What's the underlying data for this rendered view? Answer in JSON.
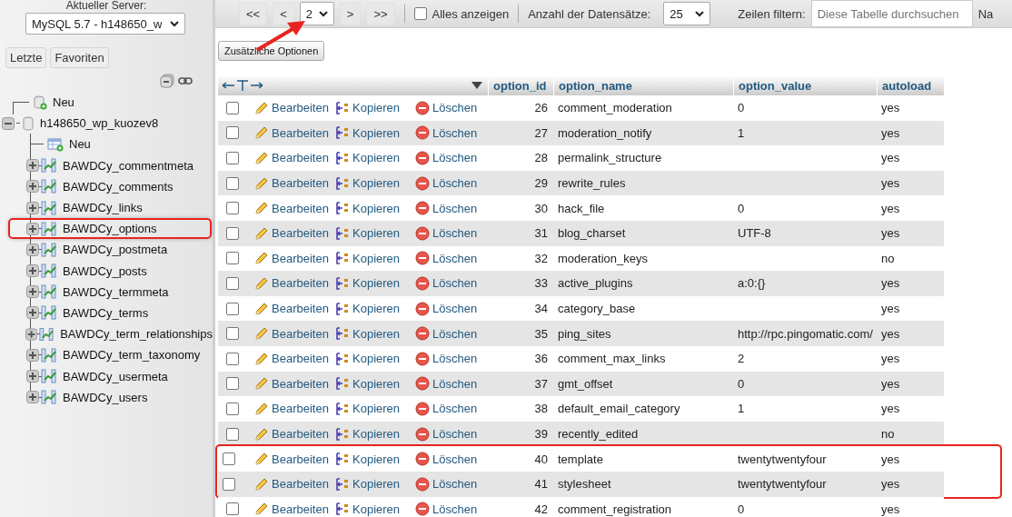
{
  "sidebar": {
    "server_label": "Aktueller Server:",
    "server_select": {
      "value": "MySQL 5.7 - h148650_w"
    },
    "buttons": [
      "Letzte",
      "Favoriten"
    ],
    "tree": [
      {
        "label": "Neu",
        "kind": "new"
      },
      {
        "label": "h148650_wp_kuozev8",
        "kind": "database",
        "expanded": true,
        "children": [
          {
            "label": "Neu",
            "kind": "new"
          },
          {
            "label": "BAWDCy_commentmeta",
            "kind": "table",
            "expanded": false,
            "highlighted": false
          },
          {
            "label": "BAWDCy_comments",
            "kind": "table",
            "expanded": false,
            "highlighted": false
          },
          {
            "label": "BAWDCy_links",
            "kind": "table",
            "expanded": false,
            "highlighted": false
          },
          {
            "label": "BAWDCy_options",
            "kind": "table",
            "expanded": false,
            "highlighted": true
          },
          {
            "label": "BAWDCy_postmeta",
            "kind": "table",
            "expanded": false,
            "highlighted": false
          },
          {
            "label": "BAWDCy_posts",
            "kind": "table",
            "expanded": false,
            "highlighted": false
          },
          {
            "label": "BAWDCy_termmeta",
            "kind": "table",
            "expanded": false,
            "highlighted": false
          },
          {
            "label": "BAWDCy_terms",
            "kind": "table",
            "expanded": false,
            "highlighted": false
          },
          {
            "label": "BAWDCy_term_relationships",
            "kind": "table",
            "expanded": false,
            "highlighted": false
          },
          {
            "label": "BAWDCy_term_taxonomy",
            "kind": "table",
            "expanded": false,
            "highlighted": false
          },
          {
            "label": "BAWDCy_usermeta",
            "kind": "table",
            "expanded": false,
            "highlighted": false
          },
          {
            "label": "BAWDCy_users",
            "kind": "table",
            "expanded": false,
            "highlighted": false
          }
        ]
      }
    ]
  },
  "toolbar": {
    "first": "<<",
    "prev": "<",
    "page_select": {
      "value": "2",
      "pointed": true
    },
    "next": ">",
    "last": ">>",
    "show_all": {
      "label": "Alles anzeigen",
      "checked": false
    },
    "rows_label": "Anzahl der Datensätze:",
    "rows_select": {
      "value": "25"
    },
    "filter_label": "Zeilen filtern:",
    "filter": {
      "placeholder": "Diese Tabelle durchsuchen"
    },
    "cut_label": "Na"
  },
  "extra_options_button": "Zusätzliche Optionen",
  "table": {
    "columns": [
      "option_id",
      "option_name",
      "option_value",
      "autoload"
    ],
    "rows": [
      {
        "checked": false,
        "highlighted": false,
        "edit": "Bearbeiten",
        "copy": "Kopieren",
        "delete": "Löschen",
        "option_id": "26",
        "option_name": "comment_moderation",
        "option_value": "0",
        "autoload": "yes"
      },
      {
        "checked": false,
        "highlighted": false,
        "edit": "Bearbeiten",
        "copy": "Kopieren",
        "delete": "Löschen",
        "option_id": "27",
        "option_name": "moderation_notify",
        "option_value": "1",
        "autoload": "yes"
      },
      {
        "checked": false,
        "highlighted": false,
        "edit": "Bearbeiten",
        "copy": "Kopieren",
        "delete": "Löschen",
        "option_id": "28",
        "option_name": "permalink_structure",
        "autoload": "yes"
      },
      {
        "checked": false,
        "highlighted": false,
        "edit": "Bearbeiten",
        "copy": "Kopieren",
        "delete": "Löschen",
        "option_id": "29",
        "option_name": "rewrite_rules",
        "autoload": "yes"
      },
      {
        "checked": false,
        "highlighted": false,
        "edit": "Bearbeiten",
        "copy": "Kopieren",
        "delete": "Löschen",
        "option_id": "30",
        "option_name": "hack_file",
        "option_value": "0",
        "autoload": "yes"
      },
      {
        "checked": false,
        "highlighted": false,
        "edit": "Bearbeiten",
        "copy": "Kopieren",
        "delete": "Löschen",
        "option_id": "31",
        "option_name": "blog_charset",
        "option_value": "UTF-8",
        "autoload": "yes"
      },
      {
        "checked": false,
        "highlighted": false,
        "edit": "Bearbeiten",
        "copy": "Kopieren",
        "delete": "Löschen",
        "option_id": "32",
        "option_name": "moderation_keys",
        "autoload": "no"
      },
      {
        "checked": false,
        "highlighted": false,
        "edit": "Bearbeiten",
        "copy": "Kopieren",
        "delete": "Löschen",
        "option_id": "33",
        "option_name": "active_plugins",
        "option_value": "a:0:{}",
        "autoload": "yes"
      },
      {
        "checked": false,
        "highlighted": false,
        "edit": "Bearbeiten",
        "copy": "Kopieren",
        "delete": "Löschen",
        "option_id": "34",
        "option_name": "category_base",
        "autoload": "yes"
      },
      {
        "checked": false,
        "highlighted": false,
        "edit": "Bearbeiten",
        "copy": "Kopieren",
        "delete": "Löschen",
        "option_id": "35",
        "option_name": "ping_sites",
        "option_value": "http://rpc.pingomatic.com/",
        "autoload": "yes"
      },
      {
        "checked": false,
        "highlighted": false,
        "edit": "Bearbeiten",
        "copy": "Kopieren",
        "delete": "Löschen",
        "option_id": "36",
        "option_name": "comment_max_links",
        "option_value": "2",
        "autoload": "yes"
      },
      {
        "checked": false,
        "highlighted": false,
        "edit": "Bearbeiten",
        "copy": "Kopieren",
        "delete": "Löschen",
        "option_id": "37",
        "option_name": "gmt_offset",
        "option_value": "0",
        "autoload": "yes"
      },
      {
        "checked": false,
        "highlighted": false,
        "edit": "Bearbeiten",
        "copy": "Kopieren",
        "delete": "Löschen",
        "option_id": "38",
        "option_name": "default_email_category",
        "option_value": "1",
        "autoload": "yes"
      },
      {
        "checked": false,
        "highlighted": false,
        "edit": "Bearbeiten",
        "copy": "Kopieren",
        "delete": "Löschen",
        "option_id": "39",
        "option_name": "recently_edited",
        "autoload": "no"
      },
      {
        "checked": false,
        "highlighted": true,
        "edit": "Bearbeiten",
        "copy": "Kopieren",
        "delete": "Löschen",
        "option_id": "40",
        "option_name": "template",
        "option_value": "twentytwentyfour",
        "autoload": "yes"
      },
      {
        "checked": false,
        "highlighted": true,
        "edit": "Bearbeiten",
        "copy": "Kopieren",
        "delete": "Löschen",
        "option_id": "41",
        "option_name": "stylesheet",
        "option_value": "twentytwentyfour",
        "autoload": "yes"
      },
      {
        "checked": false,
        "highlighted": false,
        "edit": "Bearbeiten",
        "copy": "Kopieren",
        "delete": "Löschen",
        "option_id": "42",
        "option_name": "comment_registration",
        "option_value": "0",
        "autoload": "yes"
      }
    ]
  }
}
